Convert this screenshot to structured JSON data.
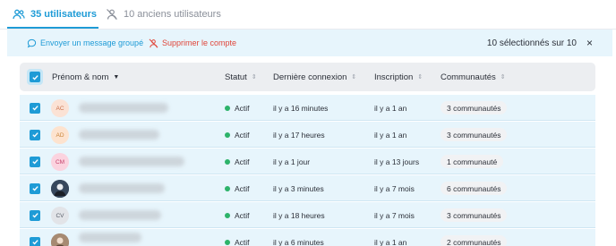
{
  "tabs": [
    {
      "label": "35 utilisateurs",
      "icon": "users-icon",
      "active": true
    },
    {
      "label": "10 anciens utilisateurs",
      "icon": "user-off-icon",
      "active": false
    }
  ],
  "actions": {
    "message": "Envoyer un message groupé",
    "delete": "Supprimer le compte",
    "selection": "10 sélectionnés sur 10",
    "close": "×"
  },
  "table": {
    "headers": {
      "name": "Prénom & nom",
      "status": "Statut",
      "last_login": "Dernière connexion",
      "signup": "Inscription",
      "communities": "Communautés"
    },
    "rows": [
      {
        "initials": "AC",
        "status": "Actif",
        "last_login": "il y a 16 minutes",
        "signup": "il y a 1 an",
        "communities": "3 communautés"
      },
      {
        "initials": "AD",
        "status": "Actif",
        "last_login": "il y a 17 heures",
        "signup": "il y a 1 an",
        "communities": "3 communautés"
      },
      {
        "initials": "CM",
        "status": "Actif",
        "last_login": "il y a 1 jour",
        "signup": "il y a 13 jours",
        "communities": "1 communauté"
      },
      {
        "initials": "",
        "status": "Actif",
        "last_login": "il y a 3 minutes",
        "signup": "il y a 7 mois",
        "communities": "6 communautés"
      },
      {
        "initials": "CV",
        "status": "Actif",
        "last_login": "il y a 18 heures",
        "signup": "il y a 7 mois",
        "communities": "3 communautés"
      },
      {
        "initials": "",
        "status": "Actif",
        "last_login": "il y a 6 minutes",
        "signup": "il y a 1 an",
        "communities": "2 communautés"
      }
    ]
  },
  "colors": {
    "accent": "#1e9bd6",
    "danger": "#e0463a",
    "selected_row": "#e7f5fc",
    "status_active": "#2db36a",
    "avatar_ac": "#fbe2d5",
    "avatar_ad": "#fde3cf",
    "avatar_cm": "#fbd3df",
    "avatar_cv": "#e2e4e8"
  }
}
